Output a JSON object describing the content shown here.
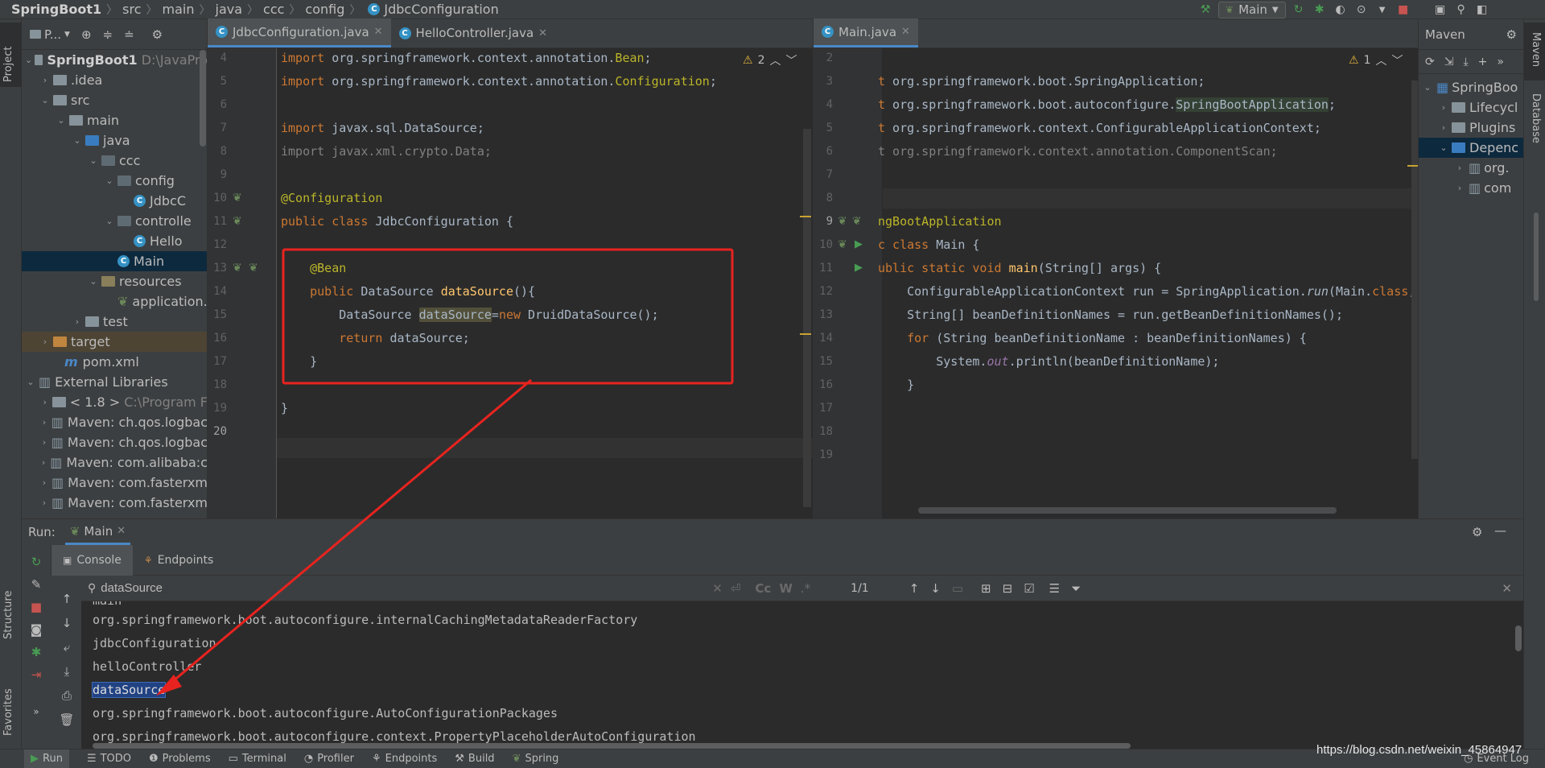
{
  "navbar": {
    "breadcrumbs": [
      "SpringBoot1",
      "src",
      "main",
      "java",
      "ccc",
      "config",
      "JdbcConfiguration"
    ],
    "run_config": "Main"
  },
  "left_strip": {
    "project": "Project",
    "structure": "Structure",
    "favorites": "Favorites"
  },
  "right_strip": {
    "maven": "Maven",
    "database": "Database"
  },
  "project": {
    "header_label": "P...",
    "tree": [
      {
        "label": "SpringBoot1",
        "extra": "D:\\JavaPro"
      },
      {
        "label": ".idea"
      },
      {
        "label": "src"
      },
      {
        "label": "main"
      },
      {
        "label": "java"
      },
      {
        "label": "ccc"
      },
      {
        "label": "config"
      },
      {
        "label": "JdbcC"
      },
      {
        "label": "controlle"
      },
      {
        "label": "Hello"
      },
      {
        "label": "Main"
      },
      {
        "label": "resources"
      },
      {
        "label": "application."
      },
      {
        "label": "test"
      },
      {
        "label": "target"
      },
      {
        "label": "pom.xml"
      },
      {
        "label": "External Libraries"
      },
      {
        "label": "< 1.8 >",
        "extra": "C:\\Program F"
      },
      {
        "label": "Maven: ch.qos.logbac"
      },
      {
        "label": "Maven: ch.qos.logbac"
      },
      {
        "label": "Maven: com.alibaba:c"
      },
      {
        "label": "Maven: com.fasterxm"
      },
      {
        "label": "Maven: com.fasterxm"
      }
    ]
  },
  "editor_left": {
    "tabs": [
      "JdbcConfiguration.java",
      "HelloController.java"
    ],
    "warnings": "2"
  },
  "editor_right": {
    "tabs": [
      "Main.java"
    ],
    "warnings": "1"
  },
  "maven": {
    "title": "Maven",
    "tree": [
      "SpringBoo",
      "Lifecycl",
      "Plugins",
      "Depenc",
      "org.",
      "com"
    ]
  },
  "run": {
    "label": "Run:",
    "config": "Main",
    "tabs": [
      "Console",
      "Endpoints"
    ],
    "search_value": "dataSource",
    "match_count": "1/1",
    "output": [
      "main",
      "org.springframework.boot.autoconfigure.internalCachingMetadataReaderFactory",
      "jdbcConfiguration",
      "helloController",
      "dataSource",
      "org.springframework.boot.autoconfigure.AutoConfigurationPackages",
      "org.springframework.boot.autoconfigure.context.PropertyPlaceholderAutoConfiguration"
    ]
  },
  "bottom": {
    "tools": [
      "Run",
      "TODO",
      "Problems",
      "Terminal",
      "Profiler",
      "Endpoints",
      "Build",
      "Spring"
    ],
    "event_log": "Event Log",
    "watermark": "https://blog.csdn.net/weixin_45864947"
  },
  "colors": {
    "highlight_box": "#e8231f",
    "arrow": "#e8231f",
    "selection": "#214283"
  }
}
